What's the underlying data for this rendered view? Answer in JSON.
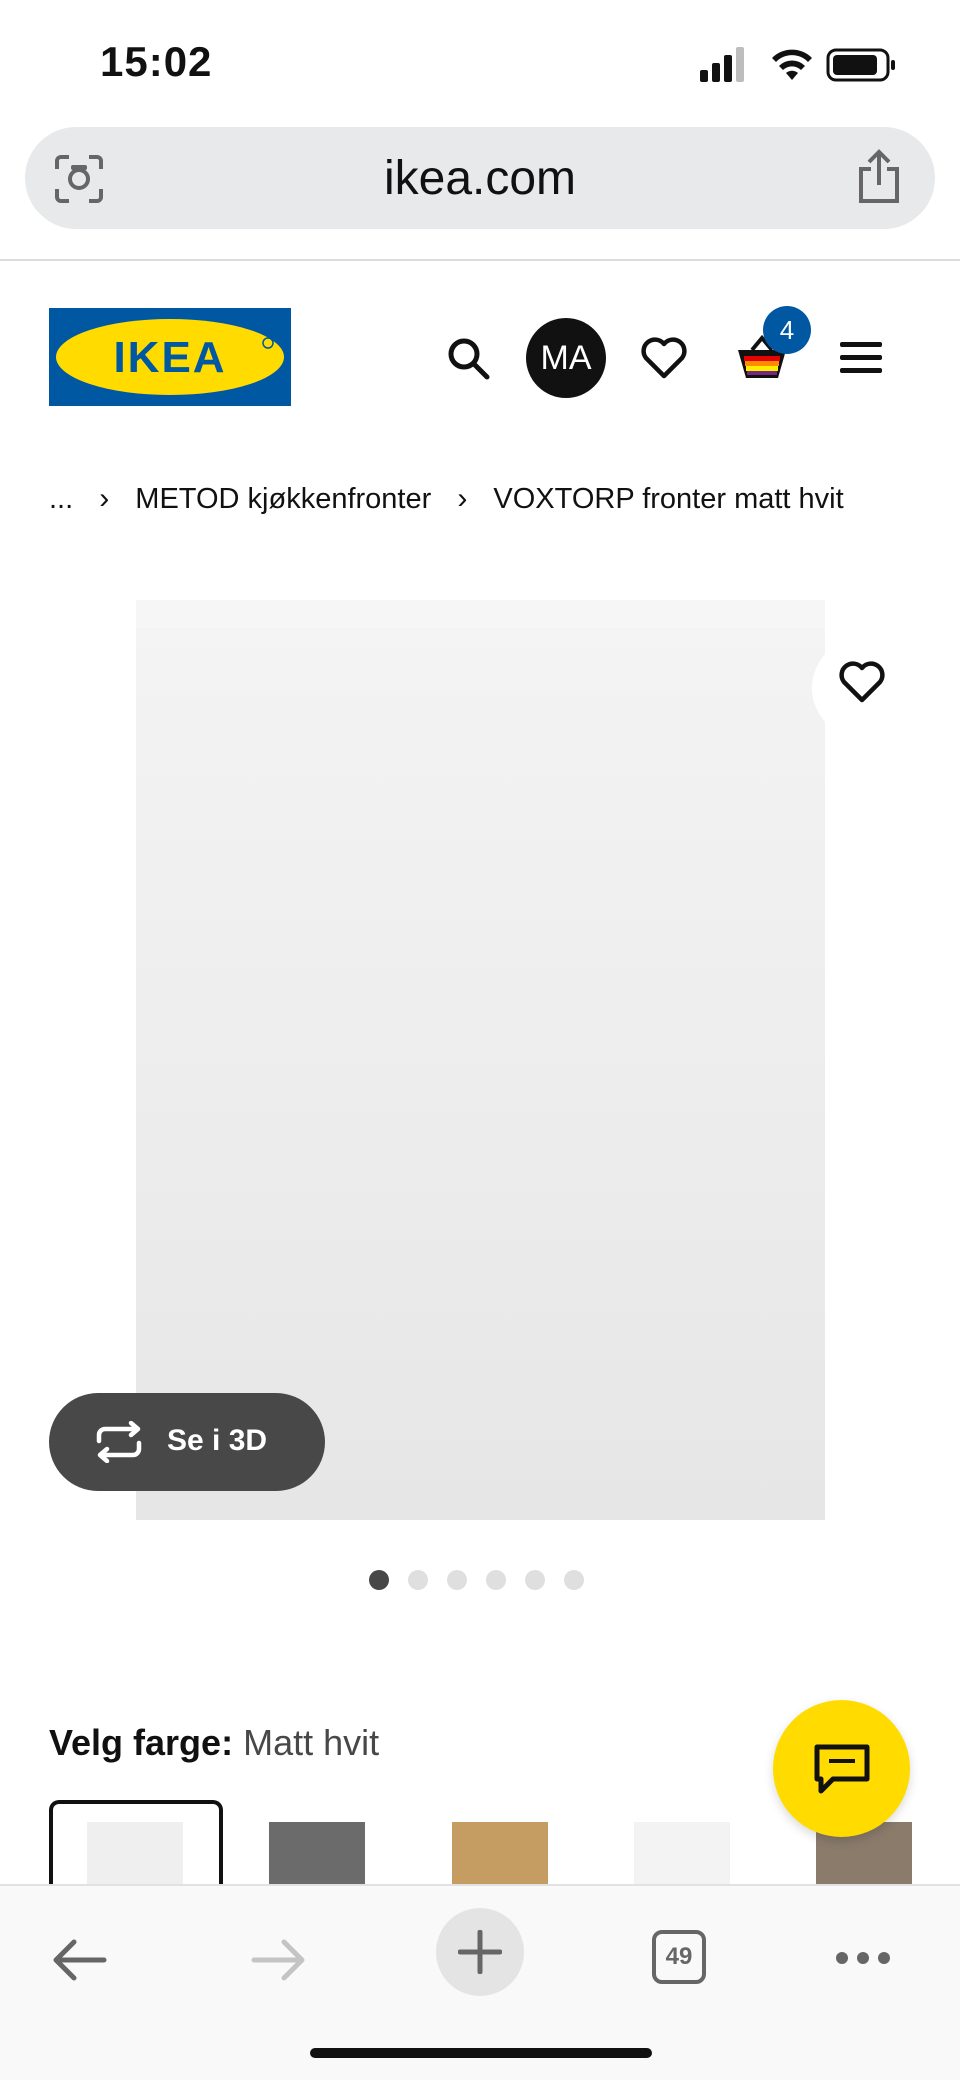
{
  "status_bar": {
    "time": "15:02"
  },
  "browser": {
    "url": "ikea.com",
    "tab_count": "49",
    "icons": [
      "lens-icon",
      "share-icon",
      "back-icon",
      "forward-icon",
      "plus-icon",
      "tabs-icon",
      "more-icon"
    ]
  },
  "header": {
    "logo_text": "IKEA",
    "avatar_initials": "MA",
    "cart_count": "4",
    "icons": [
      "search-icon",
      "heart-icon",
      "cart-icon",
      "menu-icon"
    ]
  },
  "breadcrumb": {
    "ellipsis": "...",
    "separator": "›",
    "items": [
      "METOD kjøkkenfronter",
      "VOXTORP fronter matt hvit"
    ]
  },
  "product": {
    "view_3d_label": "Se i 3D",
    "image_count": 6,
    "active_image_index": 0
  },
  "color_picker": {
    "label": "Velg farge:",
    "selected": "Matt hvit",
    "swatch_colors": [
      "#efefef",
      "#6b6b6b",
      "#c59d62",
      "#f3f3f3",
      "#8a7b6b"
    ]
  },
  "colors": {
    "ikea_blue": "#0058a3",
    "ikea_yellow": "#ffdb00",
    "chat_button": "#ffdb00",
    "view_3d_bg": "#484848"
  }
}
